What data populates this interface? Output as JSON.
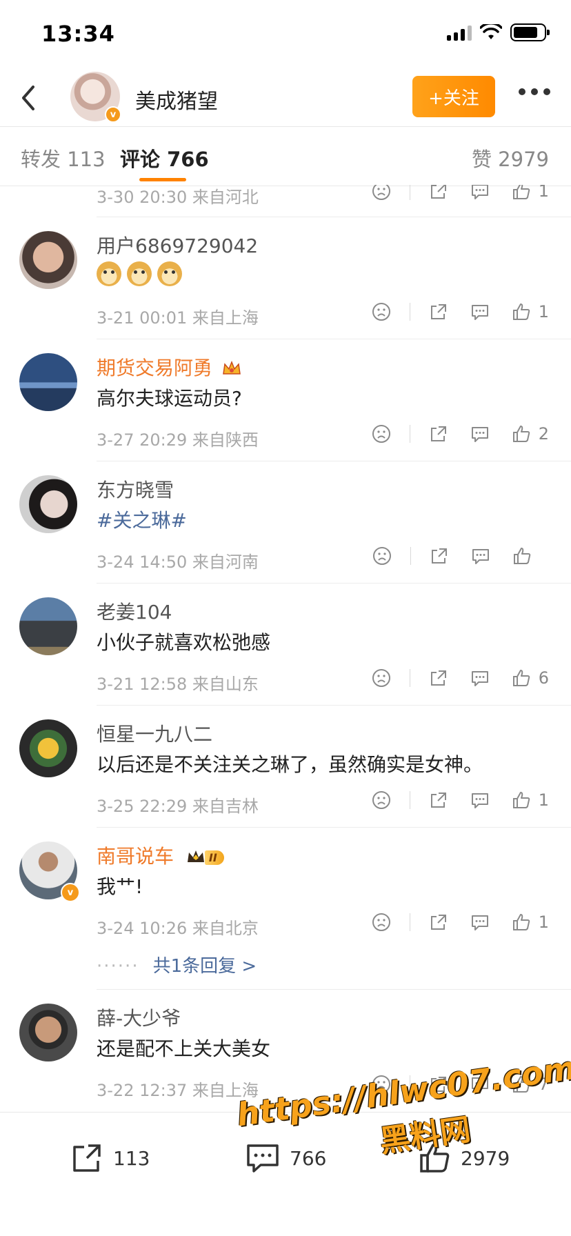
{
  "status": {
    "time": "13:34"
  },
  "header": {
    "name": "美成猪望",
    "follow_label": "+关注",
    "verified": "v"
  },
  "tabs": {
    "repost": "转发 113",
    "comment": "评论 766",
    "like": "赞 2979"
  },
  "partial_comment": {
    "meta": "3-30 20:30  来自河北",
    "likes": "1"
  },
  "comments": [
    {
      "name": "用户6869729042",
      "text": "",
      "emoji": [
        "doge",
        "doge",
        "doge"
      ],
      "meta": "3-21 00:01  来自上海",
      "likes": "1"
    },
    {
      "name": "期货交易阿勇",
      "text": "高尔夫球运动员?",
      "meta": "3-27 20:29  来自陕西",
      "likes": "2"
    },
    {
      "name": "东方晓雪",
      "text": "#关之琳#",
      "meta": "3-24 14:50  来自河南",
      "likes": ""
    },
    {
      "name": "老姜104",
      "text": "小伙子就喜欢松弛感",
      "meta": "3-21 12:58  来自山东",
      "likes": "6"
    },
    {
      "name": "恒星一九八二",
      "text": "以后还是不关注关之琳了，虽然确实是女神。",
      "meta": "3-25 22:29  来自吉林",
      "likes": "1"
    },
    {
      "name": "南哥说车",
      "badge": "II",
      "text": "我艹!",
      "meta": "3-24 10:26  来自北京",
      "likes": "1",
      "replies": "共1条回复 >"
    },
    {
      "name": "薛-大少爷",
      "text": "还是配不上关大美女",
      "meta": "3-22 12:37  来自上海",
      "likes": "7"
    }
  ],
  "bottom_bar": {
    "repost": "113",
    "comment": "766",
    "like": "2979"
  },
  "watermark": {
    "url": "https://hlwc07.com",
    "sub": "黑料网"
  },
  "colors": {
    "accent": "#ff8200",
    "orange_name": "#ef7a2a",
    "topic_blue": "#4b6a9b"
  }
}
